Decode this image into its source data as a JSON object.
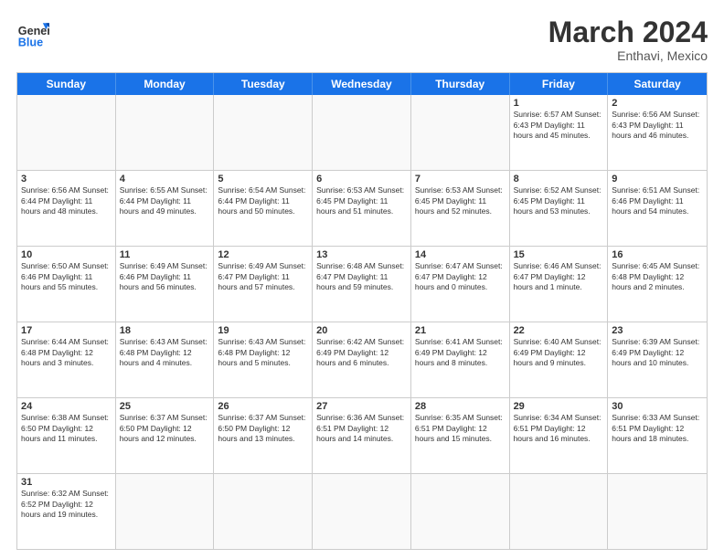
{
  "header": {
    "logo_general": "General",
    "logo_blue": "Blue",
    "month_title": "March 2024",
    "location": "Enthavi, Mexico"
  },
  "weekdays": [
    "Sunday",
    "Monday",
    "Tuesday",
    "Wednesday",
    "Thursday",
    "Friday",
    "Saturday"
  ],
  "rows": [
    [
      {
        "day": "",
        "info": ""
      },
      {
        "day": "",
        "info": ""
      },
      {
        "day": "",
        "info": ""
      },
      {
        "day": "",
        "info": ""
      },
      {
        "day": "",
        "info": ""
      },
      {
        "day": "1",
        "info": "Sunrise: 6:57 AM\nSunset: 6:43 PM\nDaylight: 11 hours\nand 45 minutes."
      },
      {
        "day": "2",
        "info": "Sunrise: 6:56 AM\nSunset: 6:43 PM\nDaylight: 11 hours\nand 46 minutes."
      }
    ],
    [
      {
        "day": "3",
        "info": "Sunrise: 6:56 AM\nSunset: 6:44 PM\nDaylight: 11 hours\nand 48 minutes."
      },
      {
        "day": "4",
        "info": "Sunrise: 6:55 AM\nSunset: 6:44 PM\nDaylight: 11 hours\nand 49 minutes."
      },
      {
        "day": "5",
        "info": "Sunrise: 6:54 AM\nSunset: 6:44 PM\nDaylight: 11 hours\nand 50 minutes."
      },
      {
        "day": "6",
        "info": "Sunrise: 6:53 AM\nSunset: 6:45 PM\nDaylight: 11 hours\nand 51 minutes."
      },
      {
        "day": "7",
        "info": "Sunrise: 6:53 AM\nSunset: 6:45 PM\nDaylight: 11 hours\nand 52 minutes."
      },
      {
        "day": "8",
        "info": "Sunrise: 6:52 AM\nSunset: 6:45 PM\nDaylight: 11 hours\nand 53 minutes."
      },
      {
        "day": "9",
        "info": "Sunrise: 6:51 AM\nSunset: 6:46 PM\nDaylight: 11 hours\nand 54 minutes."
      }
    ],
    [
      {
        "day": "10",
        "info": "Sunrise: 6:50 AM\nSunset: 6:46 PM\nDaylight: 11 hours\nand 55 minutes."
      },
      {
        "day": "11",
        "info": "Sunrise: 6:49 AM\nSunset: 6:46 PM\nDaylight: 11 hours\nand 56 minutes."
      },
      {
        "day": "12",
        "info": "Sunrise: 6:49 AM\nSunset: 6:47 PM\nDaylight: 11 hours\nand 57 minutes."
      },
      {
        "day": "13",
        "info": "Sunrise: 6:48 AM\nSunset: 6:47 PM\nDaylight: 11 hours\nand 59 minutes."
      },
      {
        "day": "14",
        "info": "Sunrise: 6:47 AM\nSunset: 6:47 PM\nDaylight: 12 hours\nand 0 minutes."
      },
      {
        "day": "15",
        "info": "Sunrise: 6:46 AM\nSunset: 6:47 PM\nDaylight: 12 hours\nand 1 minute."
      },
      {
        "day": "16",
        "info": "Sunrise: 6:45 AM\nSunset: 6:48 PM\nDaylight: 12 hours\nand 2 minutes."
      }
    ],
    [
      {
        "day": "17",
        "info": "Sunrise: 6:44 AM\nSunset: 6:48 PM\nDaylight: 12 hours\nand 3 minutes."
      },
      {
        "day": "18",
        "info": "Sunrise: 6:43 AM\nSunset: 6:48 PM\nDaylight: 12 hours\nand 4 minutes."
      },
      {
        "day": "19",
        "info": "Sunrise: 6:43 AM\nSunset: 6:48 PM\nDaylight: 12 hours\nand 5 minutes."
      },
      {
        "day": "20",
        "info": "Sunrise: 6:42 AM\nSunset: 6:49 PM\nDaylight: 12 hours\nand 6 minutes."
      },
      {
        "day": "21",
        "info": "Sunrise: 6:41 AM\nSunset: 6:49 PM\nDaylight: 12 hours\nand 8 minutes."
      },
      {
        "day": "22",
        "info": "Sunrise: 6:40 AM\nSunset: 6:49 PM\nDaylight: 12 hours\nand 9 minutes."
      },
      {
        "day": "23",
        "info": "Sunrise: 6:39 AM\nSunset: 6:49 PM\nDaylight: 12 hours\nand 10 minutes."
      }
    ],
    [
      {
        "day": "24",
        "info": "Sunrise: 6:38 AM\nSunset: 6:50 PM\nDaylight: 12 hours\nand 11 minutes."
      },
      {
        "day": "25",
        "info": "Sunrise: 6:37 AM\nSunset: 6:50 PM\nDaylight: 12 hours\nand 12 minutes."
      },
      {
        "day": "26",
        "info": "Sunrise: 6:37 AM\nSunset: 6:50 PM\nDaylight: 12 hours\nand 13 minutes."
      },
      {
        "day": "27",
        "info": "Sunrise: 6:36 AM\nSunset: 6:51 PM\nDaylight: 12 hours\nand 14 minutes."
      },
      {
        "day": "28",
        "info": "Sunrise: 6:35 AM\nSunset: 6:51 PM\nDaylight: 12 hours\nand 15 minutes."
      },
      {
        "day": "29",
        "info": "Sunrise: 6:34 AM\nSunset: 6:51 PM\nDaylight: 12 hours\nand 16 minutes."
      },
      {
        "day": "30",
        "info": "Sunrise: 6:33 AM\nSunset: 6:51 PM\nDaylight: 12 hours\nand 18 minutes."
      }
    ],
    [
      {
        "day": "31",
        "info": "Sunrise: 6:32 AM\nSunset: 6:52 PM\nDaylight: 12 hours\nand 19 minutes."
      },
      {
        "day": "",
        "info": ""
      },
      {
        "day": "",
        "info": ""
      },
      {
        "day": "",
        "info": ""
      },
      {
        "day": "",
        "info": ""
      },
      {
        "day": "",
        "info": ""
      },
      {
        "day": "",
        "info": ""
      }
    ]
  ]
}
